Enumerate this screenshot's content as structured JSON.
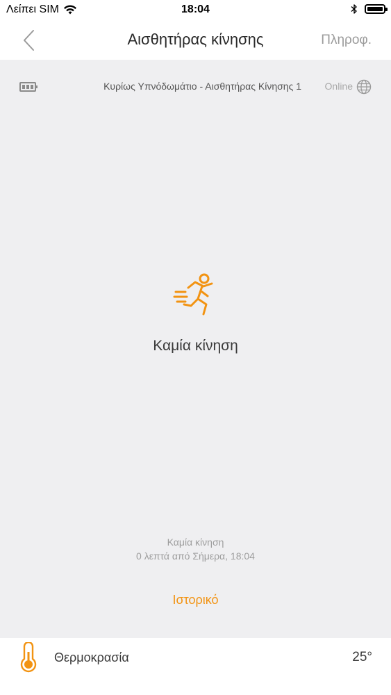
{
  "status_bar": {
    "carrier": "Λείπει SIM",
    "time": "18:04"
  },
  "nav": {
    "title": "Αισθητήρας κίνησης",
    "info_label": "Πληροφ."
  },
  "device": {
    "name": "Κυρίως Υπνόδωμάτιο - Αισθητήρας Κίνησης 1",
    "status": "Online"
  },
  "state": {
    "label": "Καμία κίνηση"
  },
  "last_event": {
    "title": "Καμία κίνηση",
    "time": "0 λεπτά από Σήμερα, 18:04"
  },
  "history": {
    "label": "Ιστορικό"
  },
  "temperature": {
    "label": "Θερμοκρασία",
    "value": "25°"
  },
  "colors": {
    "accent": "#f29312",
    "background": "#efeff1"
  }
}
